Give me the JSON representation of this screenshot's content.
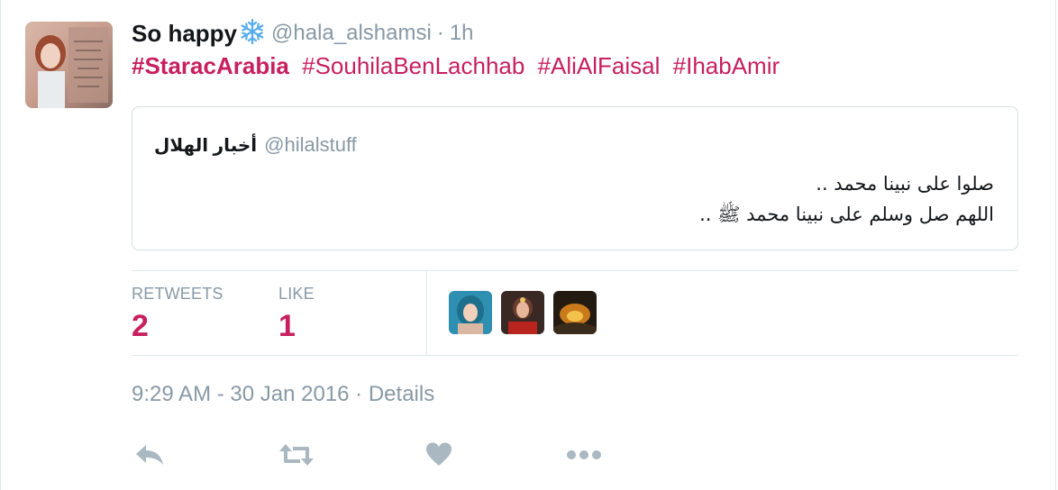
{
  "tweet": {
    "author_name": "So happy",
    "author_name_emoji": "snowflake-icon",
    "handle": "@hala_alshamsi",
    "separator": "·",
    "age": "1h",
    "hashtags": [
      "#StaracArabia",
      "#SouhilaBenLachhab",
      "#AliAlFaisal",
      "#IhabAmir"
    ]
  },
  "quote": {
    "name": "أخبار الهلال",
    "handle": "@hilalstuff",
    "lines": [
      "صلوا على نبينا محمد ..",
      "اللهم صل وسلم على نبينا محمد ﷺ .."
    ]
  },
  "stats": {
    "retweets_label": "RETWEETS",
    "retweets_count": "2",
    "likes_label": "LIKE",
    "likes_count": "1"
  },
  "timestamp": {
    "time": "9:29 AM - 30 Jan 2016",
    "separator": "·",
    "details_label": "Details"
  },
  "colors": {
    "accent": "#c71f5f",
    "muted": "#8899a6",
    "border": "#e1e8ed",
    "snowflake": "#55acee"
  },
  "actions": [
    "reply-icon",
    "retweet-icon",
    "like-icon",
    "more-icon"
  ]
}
